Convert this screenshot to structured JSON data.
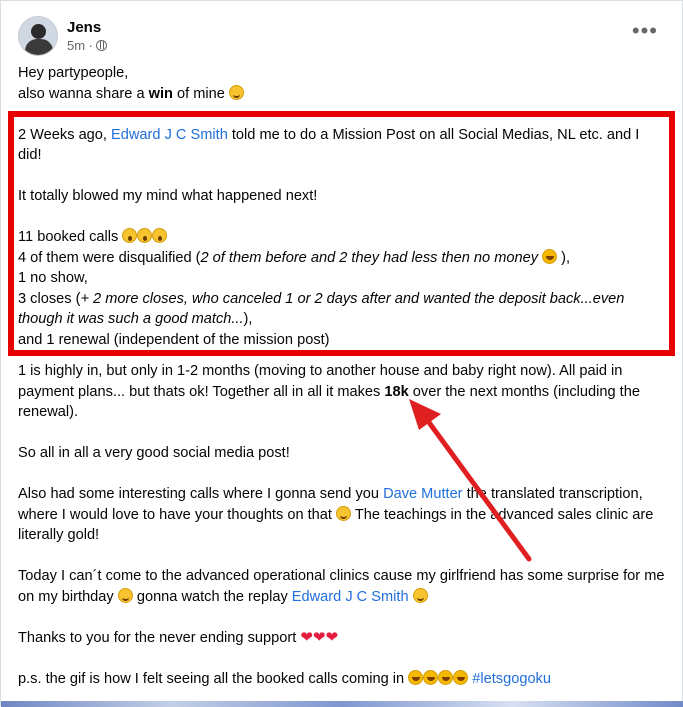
{
  "post": {
    "author": "Jens",
    "time": "5m ·",
    "lines": {
      "l1": "Hey partypeople,",
      "l2a": "also wanna share a ",
      "l2b": "win",
      "l2c": " of mine",
      "l3a": "2 Weeks ago, ",
      "l3link": "Edward J C Smith",
      "l3b": " told me to do a Mission Post on all Social Medias, NL etc. and I did!",
      "l4": "It totally blowed my mind what happened next!",
      "l5": "11 booked calls",
      "l6a": "4 of them were disqualified (",
      "l6i": "2 of them before and 2 they had less then no money",
      "l6b": " ),",
      "l7": "1 no show,",
      "l8a": "3 closes (",
      "l8i": "+ 2 more closes, who canceled 1 or 2 days after and wanted the deposit back...even though it was such a good match...",
      "l8b": "),",
      "l9": "and 1 renewal (independent of the mission post)",
      "l10a": "1 is highly in, but only in 1-2 months (moving to another house and baby right now). All paid in payment plans... but thats ok! Together all in all it makes ",
      "l10b": "18k",
      "l10c": " over the next months (including the renewal).",
      "l11": "So all in all a very good social media post!",
      "l12a": "Also had some interesting calls where I gonna send you ",
      "l12link": "Dave Mutter",
      "l12b": " the translated transcription, where I would love to have your thoughts on that",
      "l12c": " The teachings in the advanced sales clinic are literally gold!",
      "l13a": "Today I can´t come to the advanced operational clinics cause my girlfriend has some surprise for me on my birthday",
      "l13b": " gonna watch the replay ",
      "l13link": "Edward J C Smith",
      "l14": "Thanks to you for the never ending support",
      "l14hearts": "❤❤❤",
      "l15": "p.s. the gif is how I felt seeing all the booked calls coming in",
      "l15tag": "#letsgogoku"
    }
  },
  "icons": {
    "menu": "more-options-icon",
    "privacy": "globe-icon"
  },
  "colors": {
    "highlight_box": "#e60000",
    "arrow": "#e02020",
    "link": "#216fdb"
  }
}
